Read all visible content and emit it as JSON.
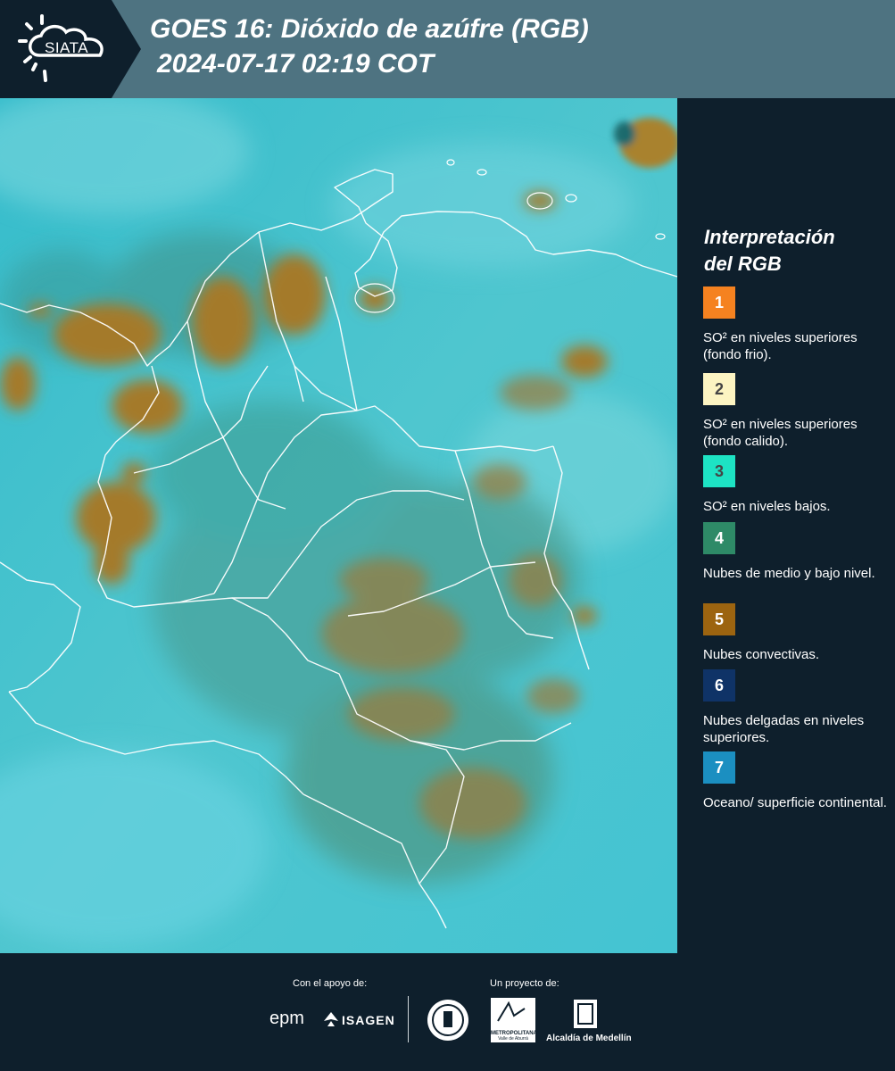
{
  "header": {
    "logo_text": "SIATA",
    "title_line1": "GOES 16: Dióxido de azúfre (RGB)",
    "title_line2": "2024-07-17 02:19 COT"
  },
  "legend": {
    "title_line1": "Interpretación",
    "title_line2": "del RGB",
    "items": [
      {
        "number": "1",
        "label": "SO² en niveles superiores (fondo frio).",
        "color": "#f58220"
      },
      {
        "number": "2",
        "label": "SO² en niveles superiores (fondo calido).",
        "color": "#fcf4c2"
      },
      {
        "number": "3",
        "label": "SO² en niveles bajos.",
        "color": "#1de3c4"
      },
      {
        "number": "4",
        "label": "Nubes de medio y bajo nivel.",
        "color": "#2e8a67"
      },
      {
        "number": "5",
        "label": "Nubes convectivas.",
        "color": "#9c6410"
      },
      {
        "number": "6",
        "label": "Nubes delgadas en niveles superiores.",
        "color": "#0f3367"
      },
      {
        "number": "7",
        "label": "Oceano/ superficie continental.",
        "color": "#1b8fc1"
      }
    ]
  },
  "footer": {
    "support_label": "Con el apoyo de:",
    "project_label": "Un proyecto de:",
    "sponsor_epm": "epm",
    "sponsor_isagen": "ISAGEN",
    "sponsor_metro": "METROPOLITANA",
    "sponsor_metro_sub": "Valle de Aburrá",
    "sponsor_alcaldia": "Alcaldía de Medellín"
  },
  "colors": {
    "background": "#0e1f2c",
    "header": "#4e7381",
    "map_base": "#3fc3d2",
    "convective": "#a77e2d"
  }
}
